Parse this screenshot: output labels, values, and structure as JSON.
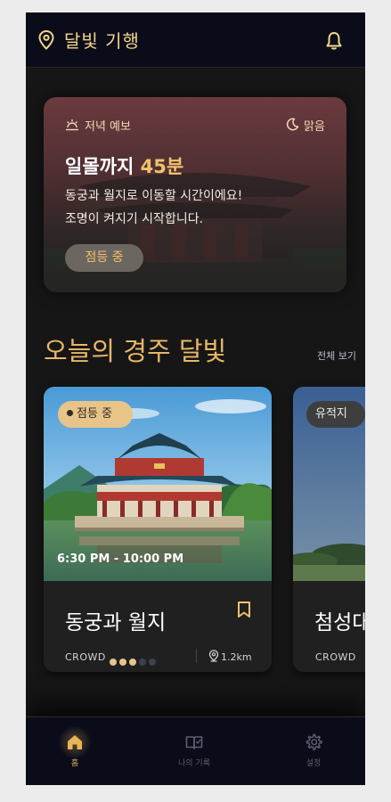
{
  "colors": {
    "accent": "#f0c36d",
    "background": "#161616",
    "bar": "#0b0c1a"
  },
  "header": {
    "title": "달빛 기행",
    "location_icon": "map-pin-icon",
    "notify_icon": "bell-icon"
  },
  "evening_card": {
    "forecast_label": "저녁 예보",
    "weather": "맑음",
    "sunset_prefix": "일몰까지",
    "sunset_minutes": "45분",
    "description_line1": "동궁과 월지로 이동할 시간이에요!",
    "description_line2": "조명이 켜지기 시작합니다.",
    "button": "점등 중"
  },
  "section": {
    "title": "오늘의 경주 달빛",
    "see_all": "전체 보기"
  },
  "places": [
    {
      "badge": "점등 중",
      "time": "6:30 PM - 10:00 PM",
      "name": "동궁과 월지",
      "crowd_label": "CROWD",
      "crowd_level": 3,
      "crowd_max": 5,
      "distance": "1.2km"
    },
    {
      "badge": "유적지",
      "name": "첨성대",
      "crowd_label": "CROWD"
    }
  ],
  "nav": [
    {
      "label": "홈",
      "icon": "home-icon",
      "active": true
    },
    {
      "label": "나의 기록",
      "icon": "book-icon",
      "active": false
    },
    {
      "label": "설정",
      "icon": "gear-icon",
      "active": false
    }
  ]
}
